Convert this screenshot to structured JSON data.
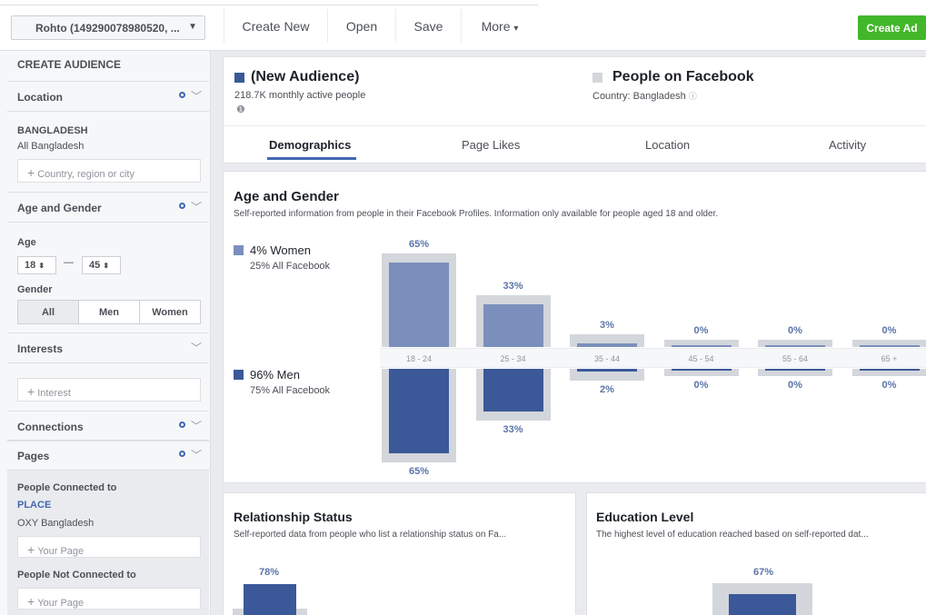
{
  "toolbar": {
    "account_label": "Rohto (149290078980520, ...",
    "create_new": "Create New",
    "open": "Open",
    "save": "Save",
    "more": "More",
    "create_ad": "Create Ad"
  },
  "sidebar": {
    "heading": "CREATE AUDIENCE",
    "location_title": "Location",
    "location_country": "BANGLADESH",
    "location_detail": "All Bangladesh",
    "location_placeholder": "Country, region or city",
    "age_gender_title": "Age and Gender",
    "age_label": "Age",
    "age_min": "18",
    "age_max": "45",
    "age_dash": "—",
    "gender_label": "Gender",
    "gender_options": [
      "All",
      "Men",
      "Women"
    ],
    "interests_title": "Interests",
    "interest_placeholder": "Interest",
    "connections_title": "Connections",
    "pages_title": "Pages",
    "connected_label": "People Connected to",
    "connected_place": "PLACE",
    "connected_page": "OXY Bangladesh",
    "your_page_placeholder": "Your Page",
    "not_connected_label": "People Not Connected to",
    "your_page_placeholder_2": "Your Page"
  },
  "header": {
    "audience_title": "(New Audience)",
    "audience_sub": "218.7K monthly active people",
    "compare_title": "People on Facebook",
    "compare_sub": "Country: Bangladesh",
    "audience_color": "#3b5998",
    "compare_color": "#d3d6db"
  },
  "tabs": [
    "Demographics",
    "Page Likes",
    "Location",
    "Activity"
  ],
  "age_gender": {
    "title": "Age and Gender",
    "subtitle": "Self-reported information from people in their Facebook Profiles. Information only available for people aged 18 and older.",
    "women_label": "4% Women",
    "women_sub": "25% All Facebook",
    "men_label": "96% Men",
    "men_sub": "75% All Facebook",
    "women_color": "#7b8fbc",
    "men_color": "#3b5998",
    "compare_color": "#d3d6db"
  },
  "chart_data": {
    "type": "bar",
    "categories": [
      "18 - 24",
      "25 - 34",
      "35 - 44",
      "45 - 54",
      "55 - 64",
      "65 +"
    ],
    "series": [
      {
        "name": "Women",
        "values": [
          65,
          33,
          3,
          0,
          0,
          0
        ]
      },
      {
        "name": "Men",
        "values": [
          65,
          33,
          2,
          0,
          0,
          0
        ]
      }
    ],
    "value_labels_women": [
      "65%",
      "33%",
      "3%",
      "0%",
      "0%",
      "0%"
    ],
    "value_labels_men": [
      "65%",
      "33%",
      "2%",
      "0%",
      "0%",
      "0%"
    ]
  },
  "relationship": {
    "title": "Relationship Status",
    "subtitle": "Self-reported data from people who list a relationship status on Fa...",
    "top_value": "78%"
  },
  "education": {
    "title": "Education Level",
    "subtitle": "The highest level of education reached based on self-reported dat...",
    "top_value": "67%"
  }
}
